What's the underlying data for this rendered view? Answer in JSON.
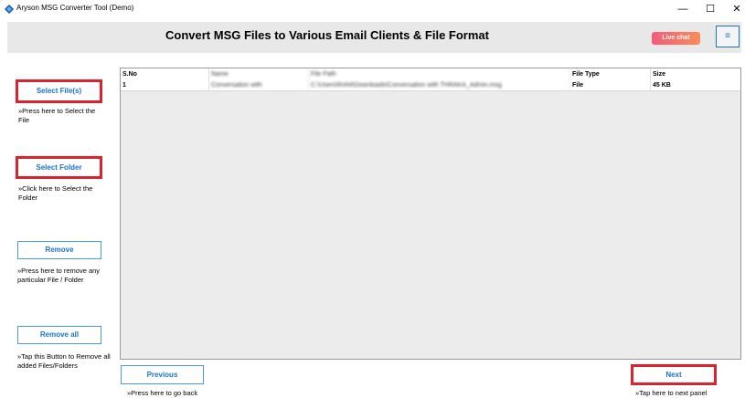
{
  "window": {
    "title": "Aryson MSG Converter Tool (Demo)",
    "minimize": "—",
    "maximize": "☐",
    "close": "✕"
  },
  "header": {
    "title": "Convert MSG Files to Various Email Clients & File Format",
    "live_chat": "Live chat",
    "menu_icon": "≡"
  },
  "sidebar": {
    "select_files": {
      "label": "Select File(s)",
      "hint": "»Press here to Select the File"
    },
    "select_folder": {
      "label": "Select Folder",
      "hint": "»Click here to Select the Folder"
    },
    "remove": {
      "label": "Remove",
      "hint": "»Press here to remove any particular File / Folder"
    },
    "remove_all": {
      "label": "Remove all",
      "hint": "»Tap this Button to Remove all added Files/Folders"
    }
  },
  "table": {
    "columns": [
      "S.No",
      "Name",
      "File Path",
      "File Type",
      "Size"
    ],
    "rows": [
      [
        "1",
        "Conversation with",
        "C:\\Users\\Rohit\\Downloads\\Conversation with THRAKA_Admin.msg",
        "File",
        "45 KB"
      ]
    ]
  },
  "footer": {
    "previous": {
      "label": "Previous",
      "hint": "»Press here to go back"
    },
    "next": {
      "label": "Next",
      "hint": "»Tap here to next panel"
    }
  },
  "colors": {
    "accent": "#1a73c7",
    "highlight": "#d9242f",
    "header_bg": "#e8e8e8"
  }
}
